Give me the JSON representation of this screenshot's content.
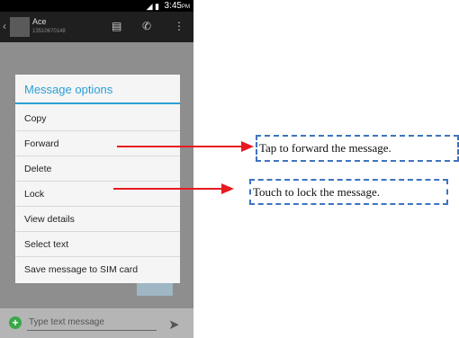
{
  "status_bar": {
    "time": "3:45",
    "ampm": "PM"
  },
  "action_bar": {
    "contact_name": "Ace",
    "contact_number": "13510670148",
    "icons": [
      "back-chevron-icon",
      "contact-card-icon",
      "phone-icon",
      "overflow-menu-icon"
    ]
  },
  "dialog": {
    "title": "Message options",
    "items": [
      {
        "label": "Copy"
      },
      {
        "label": "Forward"
      },
      {
        "label": "Delete"
      },
      {
        "label": "Lock"
      },
      {
        "label": "View details"
      },
      {
        "label": "Select text"
      },
      {
        "label": "Save message to SIM card"
      }
    ]
  },
  "compose": {
    "placeholder": "Type text message"
  },
  "annotations": {
    "forward": "Tap to forward the message.",
    "lock": "Touch to lock the message."
  },
  "colors": {
    "dialog_accent": "#2a9fd6",
    "arrow": "#e8191f",
    "callout_border": "#3d74c0",
    "compose_add": "#3aa84a"
  }
}
